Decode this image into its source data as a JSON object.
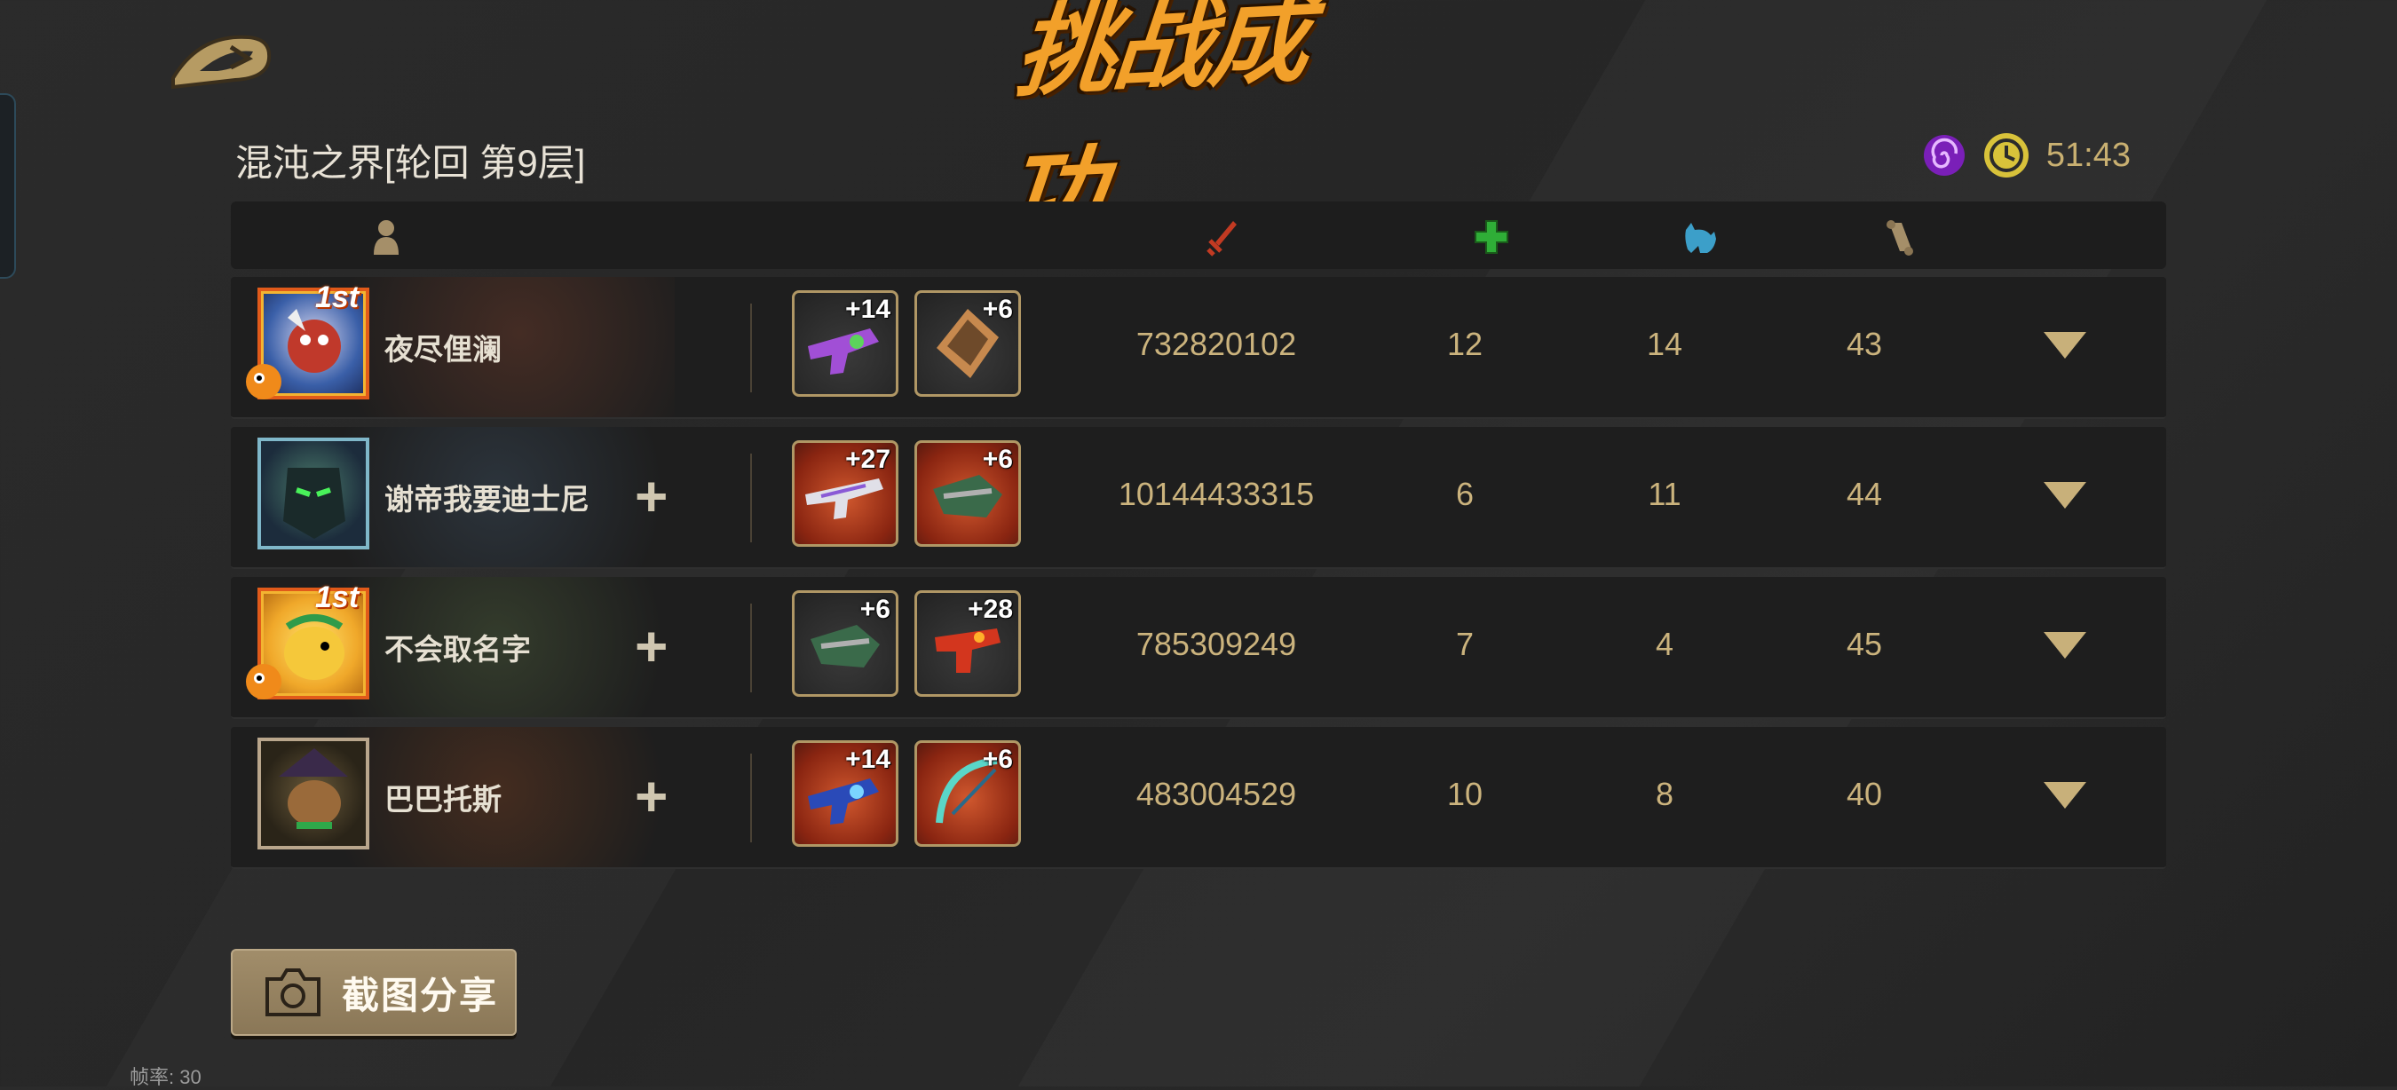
{
  "title": "挑战成功",
  "level_title": "混沌之界[轮回  第9层]",
  "timer": "51:43",
  "header_icons": [
    "player-icon",
    "sword-icon",
    "heal-cross-icon",
    "pet-icon",
    "scroll-icon"
  ],
  "players": [
    {
      "name": "夜尽俚澜",
      "rank_badge": "1st",
      "weapons": [
        "+14",
        "+6"
      ],
      "damage": "732820102",
      "heal": "12",
      "pet": "14",
      "scroll": "43"
    },
    {
      "name": "谢帝我要迪士尼",
      "rank_badge": "",
      "weapons": [
        "+27",
        "+6"
      ],
      "damage": "10144433315",
      "heal": "6",
      "pet": "11",
      "scroll": "44"
    },
    {
      "name": "不会取名字",
      "rank_badge": "1st",
      "weapons": [
        "+6",
        "+28"
      ],
      "damage": "785309249",
      "heal": "7",
      "pet": "4",
      "scroll": "45"
    },
    {
      "name": "巴巴托斯",
      "rank_badge": "",
      "weapons": [
        "+14",
        "+6"
      ],
      "damage": "483004529",
      "heal": "10",
      "pet": "8",
      "scroll": "40"
    }
  ],
  "add_symbol": "+",
  "share_button": "截图分享",
  "fps": "帧率: 30",
  "colors": {
    "accent": "#cbb37d",
    "title": "#f2a02a",
    "timer": "#c9b071"
  }
}
